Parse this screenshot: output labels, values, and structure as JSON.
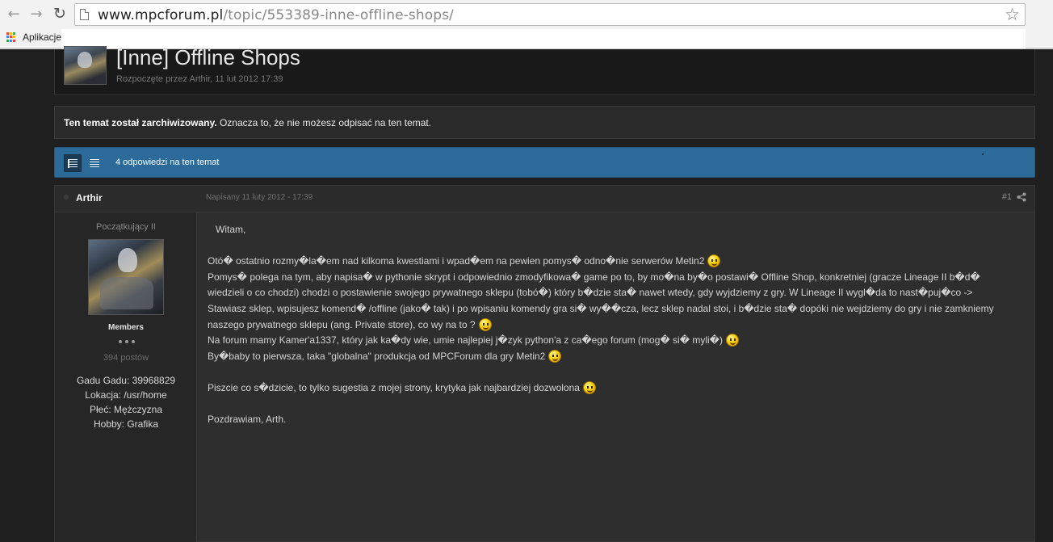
{
  "browser": {
    "url_host": "www.mpcforum.pl",
    "url_path": "/topic/553389-inne-offline-shops/",
    "bookmark_label": "Aplikacje",
    "apps_colors": [
      "#ea4335",
      "#fbbc05",
      "#34a853",
      "#4285f4",
      "#ea4335",
      "#fbbc05",
      "#34a853",
      "#4285f4",
      "#ea4335"
    ]
  },
  "topic": {
    "title": "[Inne] Offline Shops",
    "meta": "Rozpoczęte przez Arthir, 11 lut 2012 17:39"
  },
  "notice": {
    "bold": "Ten temat został zarchiwizowany.",
    "rest": " Oznacza to, że nie możesz odpisać na ten temat."
  },
  "bar": {
    "replies": "4 odpowiedzi na ten temat"
  },
  "post": {
    "author": "Arthir",
    "date": "Napisany 11 luty 2012 - 17:39",
    "number": "#1",
    "rank": "Początkujący II",
    "group": "Members",
    "post_count": "394 postów",
    "fields": [
      "Gadu Gadu: 39968829",
      "Lokacja: /usr/home",
      "Płeć: Mężczyzna",
      "Hobby: Grafika"
    ],
    "lines": {
      "l1": "Witam,",
      "l2": "Otó� ostatnio rozmy�la�em nad kilkoma kwestiami i wpad�em na pewien pomys� odno�nie serwerów Metin2",
      "l3": "Pomys� polega na tym, aby napisa� w pythonie skrypt i odpowiednio zmodyfikowa� game po to, by mo�na by�o postawi� Offline Shop, konkretniej (gracze Lineage II b�d�",
      "l4": "wiedzieli o co chodzi) chodzi o postawienie swojego prywatnego sklepu (tobó�) który b�dzie sta� nawet wtedy, gdy wyjdziemy z gry. W Lineage II wygl�da to nast�puj�co ->",
      "l5": "Stawiasz sklep, wpisujesz komend� /offline (jako� tak) i po wpisaniu komendy gra si� wy��cza, lecz sklep nadal stoi, i b�dzie sta� dopóki nie wejdziemy do gry i nie zamkniemy",
      "l6": "naszego prywatnego sklepu (ang. Private store), co wy na to ?",
      "l7": "Na forum mamy Kamer'a1337, który jak ka�dy wie, umie najlepiej j�zyk python'a z ca�ego forum (mog� si� myli�)",
      "l8": "By�baby to pierwsza, taka \"globalna\" produkcja od MPCForum dla gry Metin2",
      "l9": "Piszcie co s�dzicie, to tylko sugestia z mojej strony, krytyka jak najbardziej dozwolona",
      "l10": "Pozdrawiam, Arth."
    }
  }
}
